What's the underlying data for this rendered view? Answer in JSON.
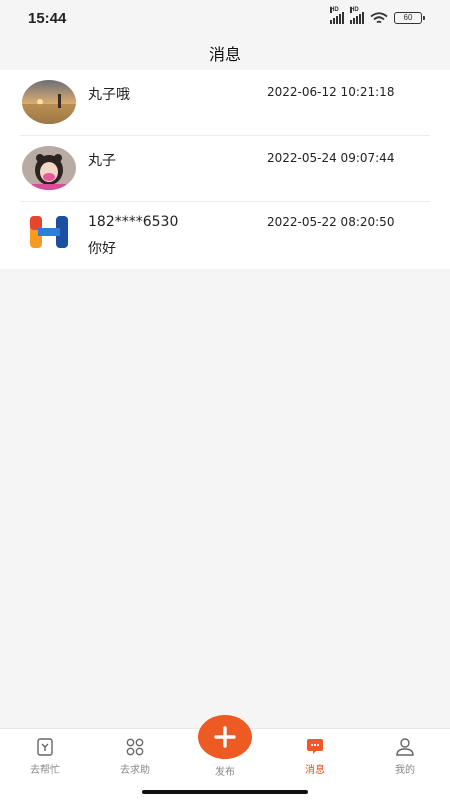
{
  "status_bar": {
    "time": "15:44",
    "battery": "60",
    "signal_label": "HD"
  },
  "header": {
    "title": "消息"
  },
  "messages": [
    {
      "name": "丸子哦",
      "time": "2022-06-12 10:21:18",
      "text": ""
    },
    {
      "name": "丸子",
      "time": "2022-05-24 09:07:44",
      "text": ""
    },
    {
      "name": "182****6530",
      "time": "2022-05-22 08:20:50",
      "text": "你好"
    }
  ],
  "tabbar": {
    "items": [
      {
        "label": "去帮忙",
        "icon": "help-task-icon"
      },
      {
        "label": "去求助",
        "icon": "grid-icon"
      },
      {
        "label": "发布",
        "icon": "plus-icon"
      },
      {
        "label": "消息",
        "icon": "chat-icon"
      },
      {
        "label": "我的",
        "icon": "user-icon"
      }
    ],
    "accent_color": "#ee5a23"
  }
}
